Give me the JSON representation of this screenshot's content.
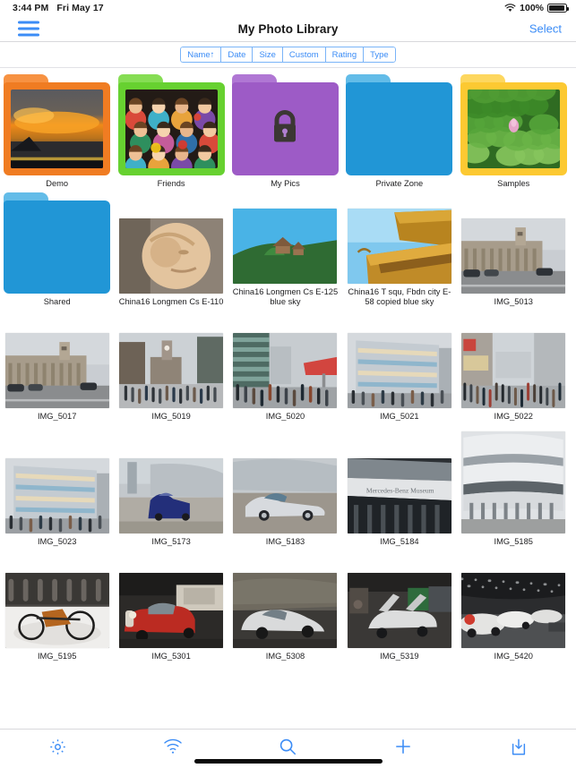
{
  "status_bar": {
    "time": "3:44 PM",
    "date": "Fri May 17",
    "battery_percent": "100%",
    "wifi_icon": "wifi-icon",
    "battery_icon": "battery-full-icon"
  },
  "nav_bar": {
    "menu_icon": "hamburger-menu-icon",
    "title": "My Photo Library",
    "select_label": "Select",
    "accent_color": "#3b8cf6"
  },
  "sort_bar": {
    "options": [
      {
        "label": "Name↑",
        "selected": true
      },
      {
        "label": "Date",
        "selected": false
      },
      {
        "label": "Size",
        "selected": false
      },
      {
        "label": "Custom",
        "selected": false
      },
      {
        "label": "Rating",
        "selected": false
      },
      {
        "label": "Type",
        "selected": false
      }
    ]
  },
  "grid": {
    "rows": [
      {
        "items": [
          {
            "kind": "folder",
            "label": "Demo",
            "color": "#F07C22",
            "tab_color": "#F79242",
            "has_photo": true,
            "photo": "sunset-storm-over-sea"
          },
          {
            "kind": "folder",
            "label": "Friends",
            "color": "#67D130",
            "tab_color": "#86DD54",
            "has_photo": true,
            "photo": "group-of-friends-party"
          },
          {
            "kind": "folder",
            "label": "My Pics",
            "color": "#9D5BC6",
            "tab_color": "#B077D4",
            "has_photo": false,
            "locked": true,
            "lock_icon": "padlock-icon"
          },
          {
            "kind": "folder",
            "label": "Private Zone",
            "color": "#2196D6",
            "tab_color": "#63BCE8",
            "has_photo": false,
            "locked": false
          },
          {
            "kind": "folder",
            "label": "Samples",
            "color": "#FCC932",
            "tab_color": "#FDD75F",
            "has_photo": true,
            "photo": "green-lotus-leaves"
          }
        ]
      },
      {
        "items": [
          {
            "kind": "folder",
            "label": "Shared",
            "color": "#2196D6",
            "tab_color": "#63BCE8",
            "has_photo": false,
            "locked": false
          },
          {
            "kind": "photo",
            "label": "China16 Longmen Cs E-110",
            "photo": "stone-buddha-carving",
            "orientation": "landscape"
          },
          {
            "kind": "photo",
            "label": "China16 Longmen Cs E-125 blue sky",
            "photo": "pagoda-on-hill-blue-sky",
            "orientation": "landscape"
          },
          {
            "kind": "photo",
            "label": "China16 T squ, Fbdn city E-58 copied blue sky",
            "photo": "forbidden-city-roof-blue-sky",
            "orientation": "landscape"
          },
          {
            "kind": "photo",
            "label": "IMG_5013",
            "photo": "city-station-building-street",
            "orientation": "landscape"
          }
        ]
      },
      {
        "items": [
          {
            "kind": "photo",
            "label": "IMG_5017",
            "photo": "stuttgart-station-colonnade",
            "orientation": "landscape"
          },
          {
            "kind": "photo",
            "label": "IMG_5019",
            "photo": "clock-tower-pedestrian-square",
            "orientation": "landscape"
          },
          {
            "kind": "photo",
            "label": "IMG_5020",
            "photo": "shopping-street-red-awning",
            "orientation": "landscape"
          },
          {
            "kind": "photo",
            "label": "IMG_5021",
            "photo": "glass-corner-department-store",
            "orientation": "landscape"
          },
          {
            "kind": "photo",
            "label": "IMG_5022",
            "photo": "crowded-shopping-boulevard",
            "orientation": "landscape"
          }
        ]
      },
      {
        "items": [
          {
            "kind": "photo",
            "label": "IMG_5023",
            "photo": "modern-shopping-mall-crowd",
            "orientation": "landscape"
          },
          {
            "kind": "photo",
            "label": "IMG_5173",
            "photo": "blue-sedan-outside-museum",
            "orientation": "landscape"
          },
          {
            "kind": "photo",
            "label": "IMG_5183",
            "photo": "silver-sports-car-outside",
            "orientation": "landscape"
          },
          {
            "kind": "photo",
            "label": "IMG_5184",
            "photo": "mercedes-benz-museum-sign",
            "orientation": "landscape"
          },
          {
            "kind": "photo",
            "label": "IMG_5185",
            "photo": "mercedes-benz-museum-facade",
            "orientation": "portrait"
          }
        ]
      },
      {
        "items": [
          {
            "kind": "photo",
            "label": "IMG_5195",
            "photo": "vintage-three-wheel-motorwagen",
            "orientation": "landscape"
          },
          {
            "kind": "photo",
            "label": "IMG_5301",
            "photo": "red-classic-sedan-museum",
            "orientation": "landscape"
          },
          {
            "kind": "photo",
            "label": "IMG_5308",
            "photo": "silver-classic-coupe-museum",
            "orientation": "landscape"
          },
          {
            "kind": "photo",
            "label": "IMG_5319",
            "photo": "gullwing-car-doors-open",
            "orientation": "landscape"
          },
          {
            "kind": "photo",
            "label": "IMG_5420",
            "photo": "racing-cars-exhibition-hall",
            "orientation": "landscape"
          }
        ]
      }
    ]
  },
  "tab_bar": {
    "items": [
      {
        "icon": "gear-icon",
        "name": "settings"
      },
      {
        "icon": "wifi-icon",
        "name": "wifi-transfer"
      },
      {
        "icon": "search-icon",
        "name": "search"
      },
      {
        "icon": "plus-icon",
        "name": "add"
      },
      {
        "icon": "import-icon",
        "name": "import"
      }
    ],
    "accent_color": "#3b8cf6"
  }
}
